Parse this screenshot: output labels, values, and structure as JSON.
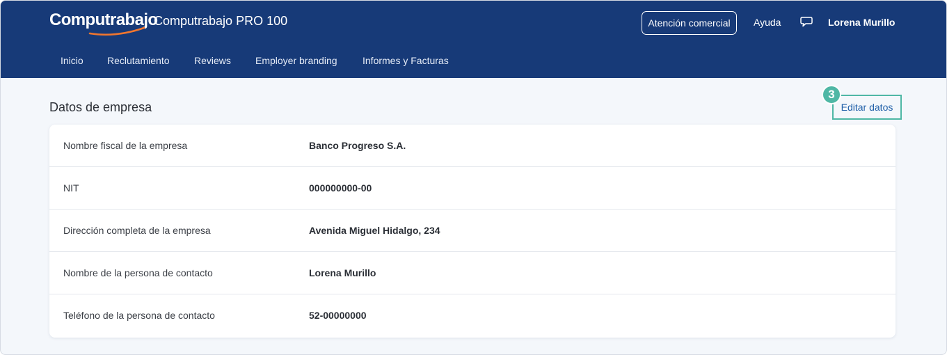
{
  "header": {
    "logo": "Computrabajo",
    "product": "Computrabajo PRO 100",
    "commercial_button": "Atención comercial",
    "help_link": "Ayuda",
    "user_name": "Lorena Murillo",
    "brand_color": "#173a78",
    "logo_accent_color": "#f2762e"
  },
  "nav": {
    "items": [
      {
        "label": "Inicio"
      },
      {
        "label": "Reclutamiento"
      },
      {
        "label": "Reviews"
      },
      {
        "label": "Employer branding"
      },
      {
        "label": "Informes y Facturas"
      }
    ]
  },
  "section": {
    "title": "Datos de empresa",
    "edit_link": "Editar datos",
    "step_badge": "3",
    "highlight_color": "#4fb7a5"
  },
  "fields": [
    {
      "label": "Nombre fiscal de la empresa",
      "value": "Banco Progreso S.A."
    },
    {
      "label": "NIT",
      "value": "000000000-00"
    },
    {
      "label": "Dirección completa de la empresa",
      "value": "Avenida Miguel Hidalgo, 234"
    },
    {
      "label": "Nombre de la persona de contacto",
      "value": "Lorena Murillo"
    },
    {
      "label": "Teléfono de la persona de contacto",
      "value": "52-00000000"
    }
  ],
  "icons": {
    "chat": "chat-bubble-icon",
    "logo_swoosh": "logo-swoosh-icon"
  }
}
